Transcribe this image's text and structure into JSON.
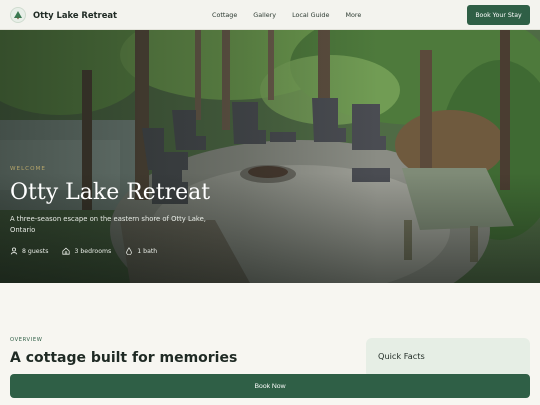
{
  "header": {
    "brand": "Otty Lake Retreat",
    "nav": [
      "Cottage",
      "Gallery",
      "Local Guide",
      "More"
    ],
    "cta": "Book Your Stay"
  },
  "hero": {
    "eyebrow": "Welcome",
    "title": "Otty Lake Retreat",
    "subtitle": "A three-season escape on the eastern shore of Otty Lake, Ontario",
    "facts": [
      {
        "icon": "guests-icon",
        "label": "8 guests"
      },
      {
        "icon": "home-icon",
        "label": "3 bedrooms"
      },
      {
        "icon": "bath-drop-icon",
        "label": "1 bath"
      }
    ]
  },
  "overview": {
    "label": "Overview",
    "title": "A cottage built for memories"
  },
  "quick_facts": {
    "title": "Quick Facts"
  },
  "book_now": "Book Now",
  "colors": {
    "accent": "#2f5f46",
    "background": "#f7f6f1"
  }
}
